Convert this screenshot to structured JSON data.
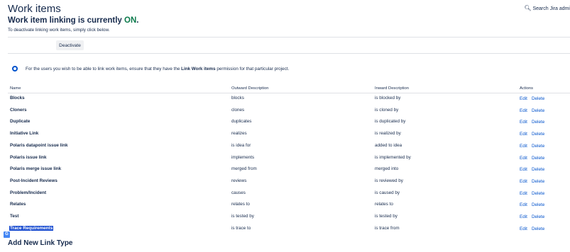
{
  "header": {
    "title": "Work items",
    "search_label": "Search Jira admi"
  },
  "status": {
    "prefix": "Work item linking is currently ",
    "state": "ON",
    "suffix": ".",
    "instruction": "To deactivate linking work items, simply click below.",
    "deactivate_label": "Deactivate"
  },
  "info": {
    "before": "For the users you wish to be able to link work items, ensure that they have the ",
    "permission": "Link Work items",
    "after": " permission for that particular project."
  },
  "table": {
    "headers": {
      "name": "Name",
      "outward": "Outward Description",
      "inward": "Inward Description",
      "actions": "Actions"
    },
    "rows": [
      {
        "name": "Blocks",
        "outward": "blocks",
        "inward": "is blocked by",
        "edit": "Edit",
        "delete": "Delete"
      },
      {
        "name": "Cloners",
        "outward": "clones",
        "inward": "is cloned by",
        "edit": "Edit",
        "delete": "Delete"
      },
      {
        "name": "Duplicate",
        "outward": "duplicates",
        "inward": "is duplicated by",
        "edit": "Edit",
        "delete": "Delete"
      },
      {
        "name": "Initiative Link",
        "outward": "realizes",
        "inward": "is realized by",
        "edit": "Edit",
        "delete": "Delete"
      },
      {
        "name": "Polaris datapoint issue link",
        "outward": "is idea for",
        "inward": "added to idea",
        "edit": "Edit",
        "delete": "Delete"
      },
      {
        "name": "Polaris issue link",
        "outward": "implements",
        "inward": "is implemented by",
        "edit": "Edit",
        "delete": "Delete"
      },
      {
        "name": "Polaris merge issue link",
        "outward": "merged from",
        "inward": "merged into",
        "edit": "Edit",
        "delete": "Delete"
      },
      {
        "name": "Post-Incident Reviews",
        "outward": "reviews",
        "inward": "is reviewed by",
        "edit": "Edit",
        "delete": "Delete"
      },
      {
        "name": "Problem/Incident",
        "outward": "causes",
        "inward": "is caused by",
        "edit": "Edit",
        "delete": "Delete"
      },
      {
        "name": "Relates",
        "outward": "relates to",
        "inward": "relates to",
        "edit": "Edit",
        "delete": "Delete"
      },
      {
        "name": "Test",
        "outward": "is tested by",
        "inward": "is tested by",
        "edit": "Edit",
        "delete": "Delete"
      },
      {
        "name": "Trace Requirements",
        "outward": "is trace to",
        "inward": "is trace from",
        "edit": "Edit",
        "delete": "Delete"
      }
    ]
  },
  "footer": {
    "add_heading": "Add New Link Type"
  },
  "icons": {
    "search": "search-icon",
    "info": "info-icon",
    "translate": "translate-icon"
  },
  "colors": {
    "link": "#0052cc",
    "on": "#0b7a4b",
    "selection": "#1d4fd1"
  }
}
